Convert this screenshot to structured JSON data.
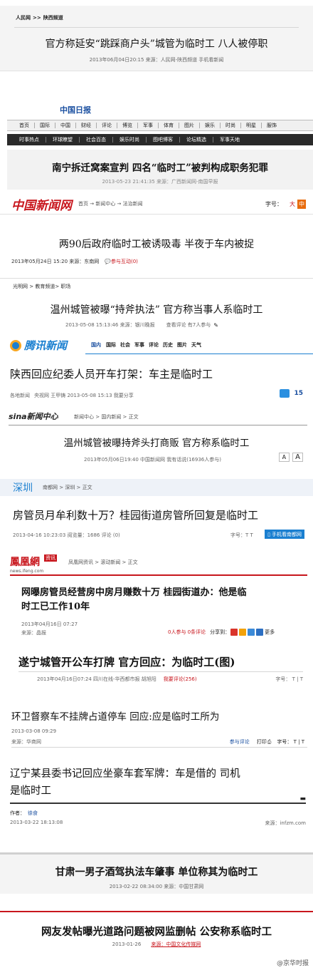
{
  "c1": {
    "breadcrumb": [
      "人民网",
      ">>",
      "陕西频道"
    ],
    "headline": "官方称延安“跳踩商户头”城管为临时工  八人被停职",
    "meta": "2013年06月04日20:15    来源：人民网-陕西频道      手机看新闻"
  },
  "c2": {
    "logo": "中国日报",
    "nav": [
      "首页",
      "国际",
      "中国",
      "财经",
      "评论",
      "博览",
      "军事",
      "体育",
      "图片",
      "娱乐",
      "时尚",
      "明星",
      "服饰"
    ],
    "subnav": [
      "时事热点",
      "环球瞭望",
      "社会百态",
      "娱乐时尚",
      "图吧博客",
      "论坛精选",
      "军事天地"
    ],
    "headline": "南宁拆迁窝案宣判  四名“临时工”被判构成职务犯罪",
    "meta": "2013-05-23 21:41:35  来源：广西新闻网-南国早报"
  },
  "c3": {
    "logo": "中国新闻网",
    "breadcrumb": "首页 → 新闻中心 → 法治新闻",
    "fontsize_label": "字号：",
    "font_big": "大",
    "font_mid": "中",
    "headline": "两90后政府临时工被诱吸毒  半夜于车内被捉",
    "meta": "2013年05月24日  15:20   来源：东南网",
    "interact": "参与互动(0)"
  },
  "c4": {
    "breadcrumb": "光明网 > 教育频道> 职场",
    "headline": "温州城管被曝“持斧执法”  官方称当事人系临时工",
    "meta": "2013-05-08  15:13:46   来源：银川晚报",
    "comments": "查看评论  有7人参与"
  },
  "c5": {
    "logo": "腾讯新闻",
    "nav": [
      "国内",
      "国际",
      "社会",
      "军事",
      "评论",
      "历史",
      "图片",
      "天气"
    ],
    "headline": "陕西回应纪委人员开车打架：车主是临时工",
    "meta_source": "各地新闻",
    "meta": "央视网  王甲铸   2013-05-08  15:13    我要分享",
    "comment_count": "15"
  },
  "c6": {
    "logo": "sina新闻中心",
    "breadcrumb": "新闻中心 > 国内新闻 > 正文",
    "headline": "温州城管被曝持斧头打商贩  官方称系临时工",
    "meta": "2013年05月06日19:40    中国新闻网    我有话说(16936人参与)",
    "font_small": "A",
    "font_large": "A"
  },
  "c7": {
    "logo": "深圳",
    "breadcrumb": "南都网 > 深圳 > 正文",
    "headline": "房管员月牟利数十万？桂园街道房管所回复是临时工",
    "meta": "2013-04-16  10:23:03   阅览量：1686   评论 (0)",
    "fontsize": "字号：T T",
    "mobile": "手机看南都网"
  },
  "c8": {
    "logo": "鳳凰網",
    "logo_tag": "资讯",
    "logo_url": "news.ifeng.com",
    "breadcrumb": "凤凰网资讯 > 滚动新闻 > 正文",
    "headline_line1": "网曝房管员经营房中房月赚数十万  桂园街道办：他是临",
    "headline_line2": "时工已工作10年",
    "date": "2013年04月16日  07:27",
    "source": "来源：晶报",
    "participation": "0人参与  0条评论",
    "share": "分享到：",
    "more": "更多"
  },
  "c9": {
    "headline": "遂宁城管开公车打牌  官方回应：为临时工(图)",
    "meta": "2013年04月16日07:24    四川在线-华西都市报    胡旭阳",
    "comment": "我要评论(256)",
    "fontsize": "字号： T | T"
  },
  "c10": {
    "headline": "环卫督察车不挂牌占道停车  回应:应是临时工所为",
    "date": "2013-03-08  09:29",
    "source": "来源：华商网",
    "comment": "参与评论",
    "print": "打印",
    "fontsize": "字号： T | T"
  },
  "c11": {
    "headline_line1": "辽宁某县委书记回应坐豪车套军牌：车是借的  司机",
    "headline_line2": "是临时工",
    "author_label": "作者：",
    "author": "徐食",
    "date": "2013-03-22  18:13:08",
    "source": "来源：infzm.com"
  },
  "c12": {
    "headline": "甘肃一男子酒驾执法车肇事  单位称其为临时工",
    "meta": "2013-02-22  08:34:00   来源：中国甘肃网"
  },
  "c13": {
    "headline": "网友发帖曝光道路问题被网监删帖  公安称系临时工",
    "meta": "2013-01-26",
    "source": "来源：中国文化传媒网"
  },
  "watermark": "@京华时报",
  "colors": {
    "red": "#c8161d",
    "blue": "#1a4fa0",
    "dark": "#2a2a2a",
    "orange": "#e86b0c",
    "gray_bg": "#f4f4f4"
  }
}
